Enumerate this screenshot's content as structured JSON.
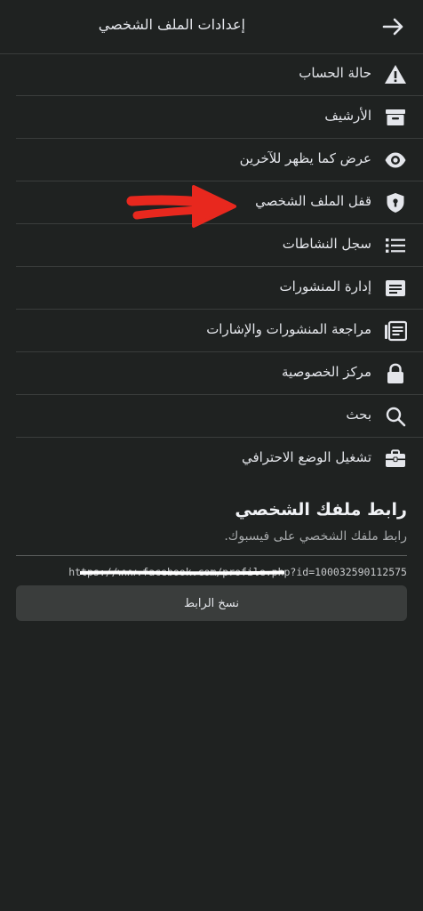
{
  "header": {
    "title": "إعدادات الملف الشخصي"
  },
  "menu": {
    "items": [
      {
        "label": "حالة الحساب",
        "icon": "warning-icon"
      },
      {
        "label": "الأرشيف",
        "icon": "archive-icon"
      },
      {
        "label": "عرض كما يظهر للآخرين",
        "icon": "eye-icon"
      },
      {
        "label": "قفل الملف الشخصي",
        "icon": "shield-lock-icon"
      },
      {
        "label": "سجل النشاطات",
        "icon": "list-icon"
      },
      {
        "label": "إدارة المنشورات",
        "icon": "posts-icon"
      },
      {
        "label": "مراجعة المنشورات والإشارات",
        "icon": "review-posts-icon"
      },
      {
        "label": "مركز الخصوصية",
        "icon": "lock-icon"
      },
      {
        "label": "بحث",
        "icon": "search-icon"
      },
      {
        "label": "تشغيل الوضع الاحترافي",
        "icon": "briefcase-icon"
      }
    ]
  },
  "profile_link": {
    "title": "رابط ملفك الشخصي",
    "subtitle": "رابط ملفك الشخصي على فيسبوك.",
    "url": "https://www.facebook.com/profile.php?id=100032590112575",
    "copy_label": "نسخ الرابط"
  },
  "colors": {
    "background": "#1f2221",
    "divider": "#3a3d3c",
    "text": "#e4e6eb",
    "annotation_arrow": "#e8281e",
    "button": "#3a3d3c"
  }
}
